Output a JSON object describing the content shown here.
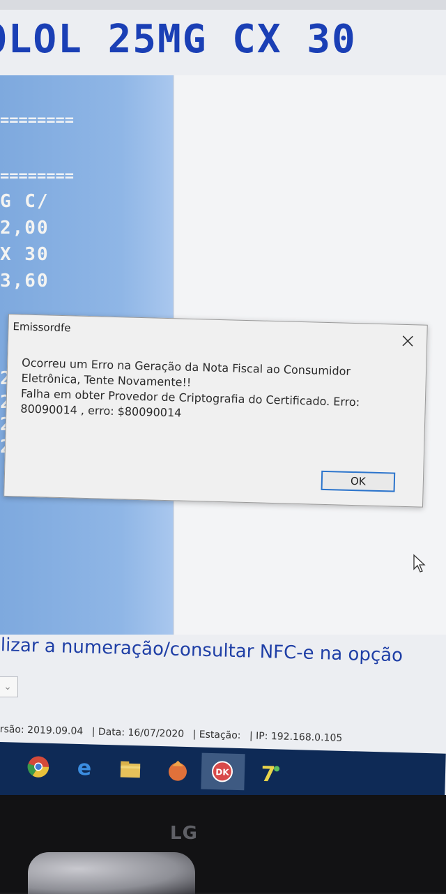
{
  "product_title": "OLOL 25MG CX 30",
  "receipt": {
    "separator_1": "========",
    "separator_2": "========",
    "line_1": "G C/",
    "line_2": "2,00",
    "line_3": "X 30",
    "line_4": "3,60",
    "line_5": "2",
    "line_6": "2",
    "line_7": "2",
    "line_8": "2"
  },
  "dialog": {
    "title": "Emissordfe",
    "message": "Ocorreu um Erro na Geração da Nota Fiscal ao Consumidor\nEletrônica, Tente Novamente!!\nFalha em obter Provedor de Criptografia do Certificado. Erro:\n80090014 , erro: $80090014",
    "ok_label": "OK",
    "close_icon": "close-icon"
  },
  "hint_text": "ilizar a numeração/consultar NFC-e na opção",
  "status_bar": {
    "version": "rsão: 2019.09.04",
    "date": "| Data: 16/07/2020",
    "station": "| Estação:",
    "ip": "| IP: 192.168.0.105"
  },
  "taskbar_icons": [
    "chrome-icon",
    "edge-icon",
    "file-explorer-icon",
    "app-icon",
    "dk-app-icon",
    "app-7-icon"
  ],
  "monitor_brand": "LG",
  "colors": {
    "title_blue": "#1a3fb5",
    "receipt_bg": "#8fb6e6",
    "ok_border": "#2b74cc",
    "taskbar": "#0e2a56"
  }
}
